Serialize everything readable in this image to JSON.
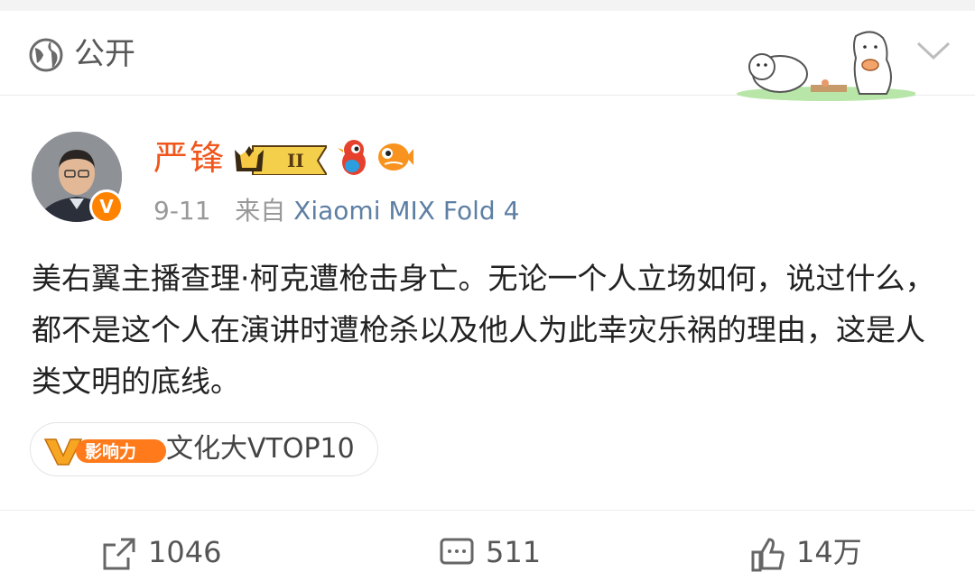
{
  "visibility": {
    "label": "公开",
    "icon": "globe-icon"
  },
  "sticker": {
    "icon": "bear-sticker-icon"
  },
  "post": {
    "author": {
      "name": "严锋",
      "badges": [
        "crown-level-badge",
        "bird-badge",
        "fish-badge"
      ],
      "verified_icon": "verified-v-icon",
      "crown_level": "II"
    },
    "date": "9-11",
    "source_prefix": "来自",
    "source_device": "Xiaomi MIX Fold 4",
    "content": "美右翼主播查理·柯克遭枪击身亡。无论一个人立场如何，说过什么，都不是这个人在演讲时遭枪杀以及他人为此幸灾乐祸的理由，这是人类文明的底线。",
    "tag": {
      "badge_text": "影响力",
      "badge_letter": "V",
      "label": "文化大VTOP10"
    }
  },
  "actions": {
    "repost": {
      "icon": "repost-icon",
      "count": "1046"
    },
    "comment": {
      "icon": "comment-icon",
      "count": "511"
    },
    "like": {
      "icon": "like-icon",
      "count": "14万"
    }
  },
  "colors": {
    "name": "#f0561c",
    "source": "#5d7fa3",
    "verified": "#ff8200",
    "text": "#222222",
    "meta": "#999999"
  }
}
